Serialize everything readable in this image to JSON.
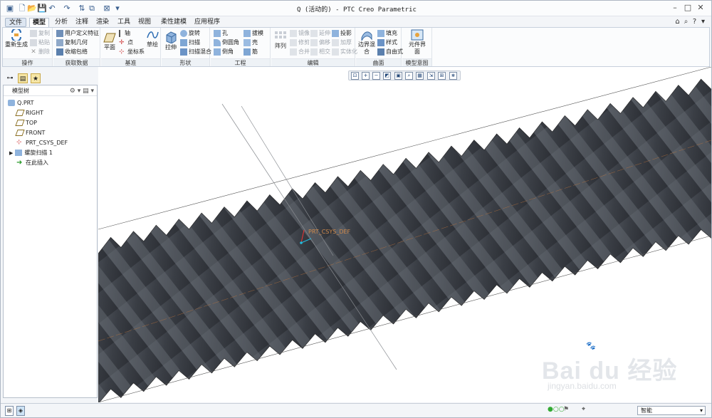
{
  "title": "Q (活动的) - PTC Creo Parametric",
  "menu_tabs": [
    "文件",
    "模型",
    "分析",
    "注释",
    "渲染",
    "工具",
    "视图",
    "柔性建模",
    "应用程序"
  ],
  "ribbon": {
    "operations": {
      "label": "操作",
      "regenerate": "重新生成",
      "copy": "复制",
      "paste": "粘贴",
      "delete": "删除"
    },
    "get_data": {
      "label": "获取数据",
      "udf": "用户定义特征",
      "copy_geom": "复制几何",
      "shrinkwrap": "收缩包络"
    },
    "datum": {
      "label": "基准",
      "plane": "平面",
      "axis": "轴",
      "point": "点",
      "csys": "坐标系",
      "sketch": "草绘"
    },
    "shapes": {
      "label": "形状",
      "extrude": "拉伸",
      "revolve": "旋转",
      "sweep": "扫描",
      "swept_blend": "扫描混合"
    },
    "engineering": {
      "label": "工程",
      "hole": "孔",
      "round": "倒圆角",
      "chamfer": "倒角",
      "draft": "拔模",
      "shell": "壳",
      "rib": "筋"
    },
    "editing": {
      "label": "编辑",
      "pattern": "阵列",
      "mirror": "镜像",
      "trim": "修剪",
      "merge": "合并",
      "extend": "延伸",
      "offset": "偏移",
      "intersect": "相交",
      "project": "投影",
      "thicken": "加厚",
      "solidify": "实体化"
    },
    "surfaces": {
      "label": "曲面",
      "boundary_blend": "边界混合",
      "fill": "填充",
      "style": "样式",
      "freestyle": "自由式"
    },
    "model_intent": {
      "label": "模型意图",
      "component_interface": "元件界面"
    }
  },
  "model_tree": {
    "header": "模型树",
    "items": [
      "Q.PRT",
      "RIGHT",
      "TOP",
      "FRONT",
      "PRT_CSYS_DEF",
      "螺旋扫描 1",
      "在此插入"
    ]
  },
  "graphics": {
    "csys_label": "PRT_CSYS_DEF"
  },
  "status": {
    "filter": "智能"
  },
  "watermark": {
    "brand": "Bai du 经验",
    "url": "jingyan.baidu.com"
  }
}
